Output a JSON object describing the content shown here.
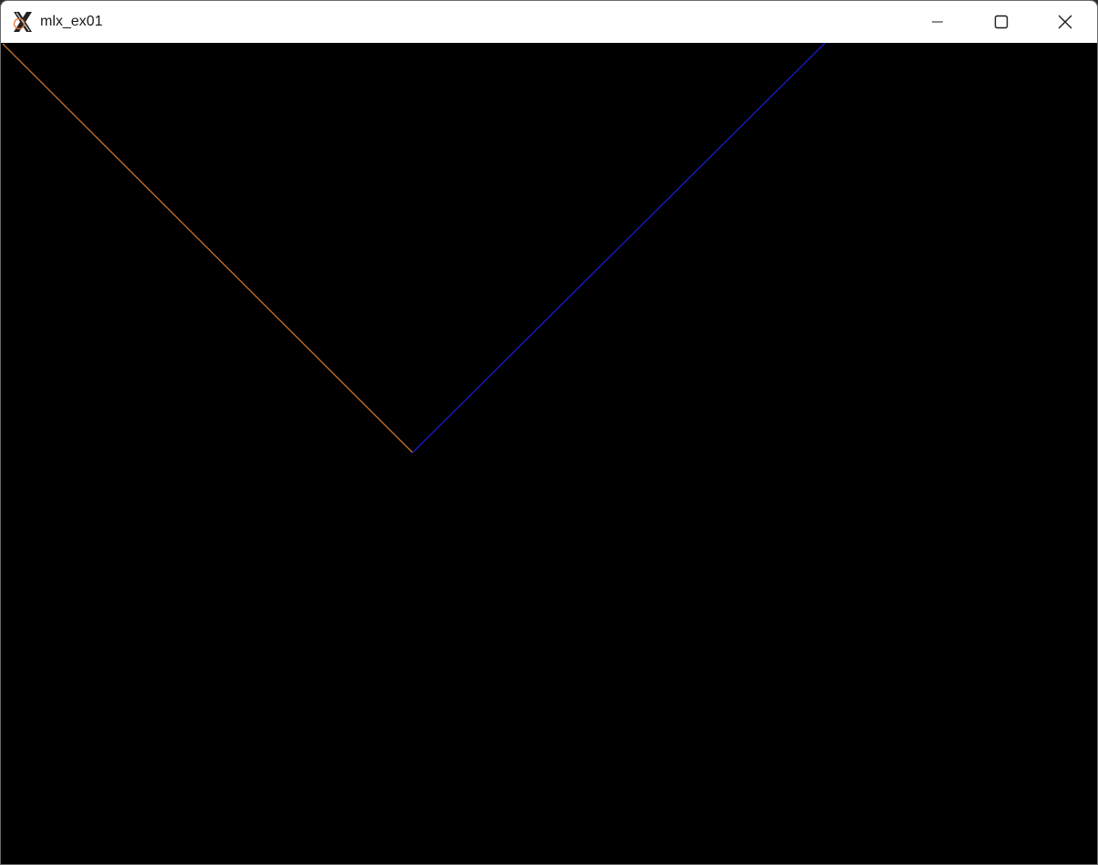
{
  "window": {
    "title": "mlx_ex01",
    "app_icon": "x11-icon",
    "controls": {
      "minimize_icon": "minimize-icon",
      "maximize_icon": "maximize-icon",
      "close_icon": "close-icon"
    }
  },
  "canvas": {
    "background": "#000000",
    "lines": [
      {
        "name": "orange-line",
        "color": "#c8702a"
      },
      {
        "name": "blue-line",
        "color": "#1a1ad0"
      }
    ]
  }
}
